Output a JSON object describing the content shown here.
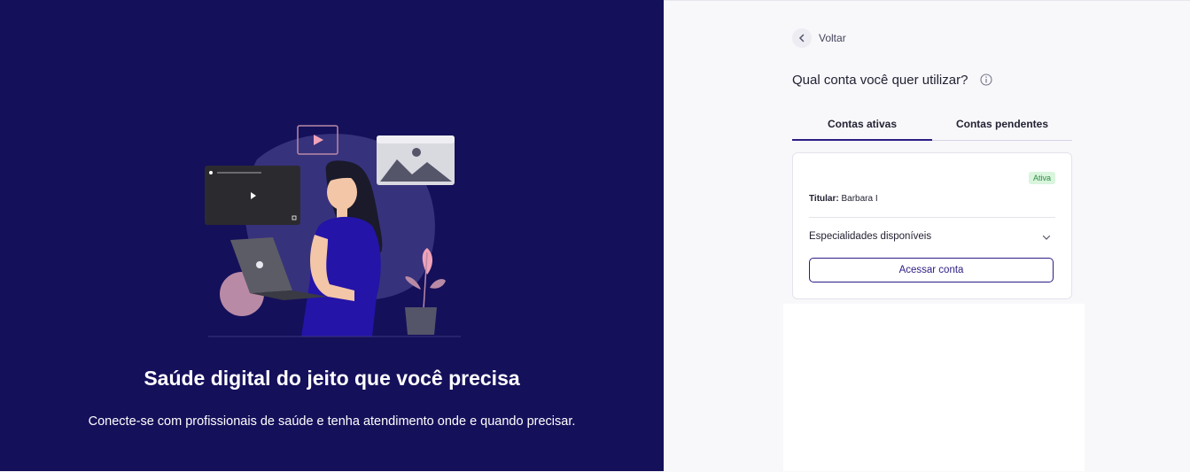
{
  "hero": {
    "title": "Saúde digital do jeito que você precisa",
    "subtitle": "Conecte-se com profissionais de saúde e tenha atendimento onde e quando precisar."
  },
  "nav": {
    "back_label": "Voltar",
    "back_icon": "chevron-left-icon"
  },
  "question": {
    "text": "Qual conta você quer utilizar?",
    "icon": "info-icon"
  },
  "tabs": [
    {
      "label": "Contas ativas",
      "active": true
    },
    {
      "label": "Contas pendentes",
      "active": false
    }
  ],
  "account_card": {
    "status": "Ativa",
    "holder_label": "Titular:",
    "holder_name": "Barbara I",
    "specialties_label": "Especialidades disponíveis",
    "access_button": "Acessar conta"
  },
  "colors": {
    "left_bg": "#15105a",
    "accent": "#2b1d84",
    "badge_bg": "#d9f5dd",
    "badge_text": "#2e8c44"
  }
}
